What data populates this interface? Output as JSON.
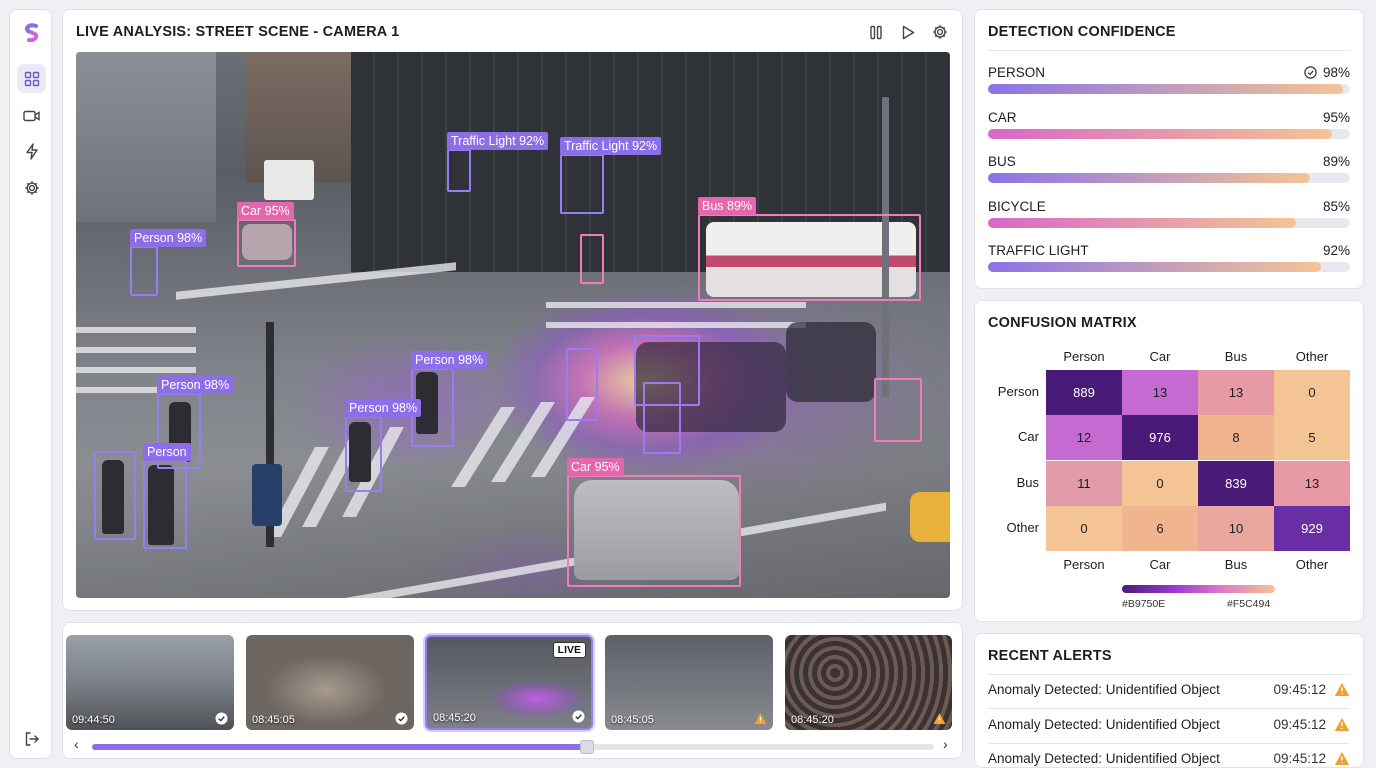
{
  "sidebar": {
    "icons": [
      "logo-icon",
      "dashboard-icon",
      "camera-icon",
      "bolt-icon",
      "settings-icon",
      "logout-icon"
    ]
  },
  "main": {
    "title": "LIVE ANALYSIS: STREET SCENE - CAMERA 1",
    "controls": [
      "pause-icon",
      "play-icon",
      "settings-icon"
    ],
    "detections": [
      {
        "label": "Traffic Light 92%",
        "kind": "p"
      },
      {
        "label": "Traffic Light 92%",
        "kind": "p"
      },
      {
        "label": "Car 95%",
        "kind": "k"
      },
      {
        "label": "Person 98%",
        "kind": "p"
      },
      {
        "label": "Bus 89%",
        "kind": "k"
      },
      {
        "label": "Person 98%",
        "kind": "p"
      },
      {
        "label": "Person 98%",
        "kind": "p"
      },
      {
        "label": "Person 98%",
        "kind": "p"
      },
      {
        "label": "Person",
        "kind": "p"
      },
      {
        "label": "Car 95%",
        "kind": "k"
      }
    ]
  },
  "strip": {
    "thumbs": [
      {
        "time": "09:44:50",
        "status": "ok",
        "live": false
      },
      {
        "time": "08:45:05",
        "status": "ok",
        "live": false
      },
      {
        "time": "08:45:20",
        "status": "ok",
        "live": true
      },
      {
        "time": "08:45:05",
        "status": "warn",
        "live": false
      },
      {
        "time": "08:45:20",
        "status": "warn",
        "live": false
      }
    ],
    "live_label": "LIVE",
    "left_arrow": "‹",
    "right_arrow": "›",
    "scrub_position": 0.588
  },
  "confidence": {
    "title": "DETECTION CONFIDENCE",
    "items": [
      {
        "label": "PERSON",
        "value": "98%",
        "pct": 98,
        "verified": true
      },
      {
        "label": "CAR",
        "value": "95%",
        "pct": 95,
        "verified": false
      },
      {
        "label": "BUS",
        "value": "89%",
        "pct": 89,
        "verified": false
      },
      {
        "label": "BICYCLE",
        "value": "85%",
        "pct": 85,
        "verified": false
      },
      {
        "label": "TRAFFIC LIGHT",
        "value": "92%",
        "pct": 92,
        "verified": false
      }
    ],
    "gradients": [
      "#8a73e8",
      "#d768c9",
      "#8a73e8",
      "#d768c9",
      "#8a73e8"
    ],
    "gradient_end": "#f5c494"
  },
  "matrix": {
    "title": "CONFUSION MATRIX",
    "col_labels": [
      "Person",
      "Car",
      "Bus",
      "Other"
    ],
    "row_labels": [
      "Person",
      "Car",
      "Bus",
      "Other"
    ],
    "values": [
      [
        "889",
        "13",
        "13",
        "0"
      ],
      [
        "12",
        "976",
        "8",
        "5"
      ],
      [
        "11",
        "0",
        "839",
        "13"
      ],
      [
        "0",
        "6",
        "10",
        "929"
      ]
    ],
    "colors": [
      [
        "#4a1a78",
        "#c56ad0",
        "#e79aa6",
        "#f5c494"
      ],
      [
        "#c56ad0",
        "#4a1a78",
        "#f0b48e",
        "#f5c494"
      ],
      [
        "#e19aa8",
        "#f5c494",
        "#4a1a78",
        "#e79aa6"
      ],
      [
        "#f5c494",
        "#f0b48e",
        "#e9a69e",
        "#6a2ea4"
      ]
    ],
    "text_colors": [
      [
        "#ffffff",
        "#1c1e26",
        "#1c1e26",
        "#1c1e26"
      ],
      [
        "#1c1e26",
        "#ffffff",
        "#1c1e26",
        "#1c1e26"
      ],
      [
        "#1c1e26",
        "#1c1e26",
        "#ffffff",
        "#1c1e26"
      ],
      [
        "#1c1e26",
        "#1c1e26",
        "#1c1e26",
        "#ffffff"
      ]
    ],
    "legend_low": "#B9750E",
    "legend_high": "#F5C494"
  },
  "alerts": {
    "title": "RECENT ALERTS",
    "items": [
      {
        "text": "Anomaly Detected: Unidentified Object",
        "time": "09:45:12"
      },
      {
        "text": "Anomaly Detected: Unidentified Object",
        "time": "09:45:12"
      },
      {
        "text": "Anomaly Detected: Unidentified Object",
        "time": "09:45:12"
      }
    ]
  }
}
